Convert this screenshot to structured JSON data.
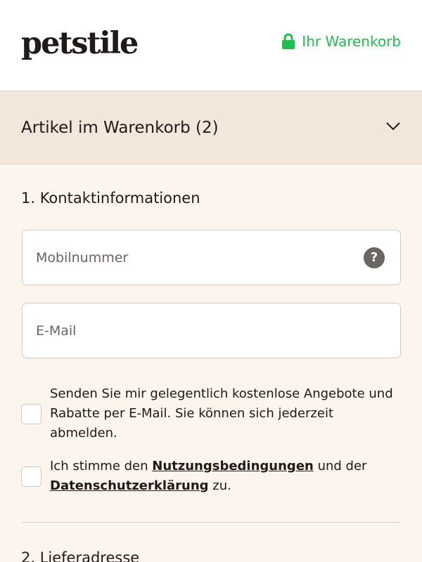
{
  "header": {
    "logo_text": "petstile",
    "cart_label": "Ihr Warenkorb",
    "cart_icon": "lock-icon",
    "accent_color": "#1fbf4f"
  },
  "summary": {
    "title": "Artikel im Warenkorb (2)",
    "toggle_icon": "chevron-down-icon"
  },
  "contact": {
    "title": "1. Kontaktinformationen",
    "phone_placeholder": "Mobilnummer",
    "phone_value": "",
    "help_icon": "question-mark-icon",
    "email_placeholder": "E-Mail",
    "email_value": "",
    "newsletter_text": "Senden Sie mir gelegentlich kostenlose Angebote und Rabatte per E-Mail. Sie können sich jederzeit abmelden.",
    "newsletter_checked": false,
    "terms_prefix": "Ich stimme den ",
    "terms_link": "Nutzungsbedingungen",
    "terms_middle": " und der ",
    "privacy_link": "Datenschutzerklärung",
    "terms_suffix": " zu.",
    "terms_checked": false
  },
  "delivery": {
    "title": "2. Lieferadresse"
  }
}
